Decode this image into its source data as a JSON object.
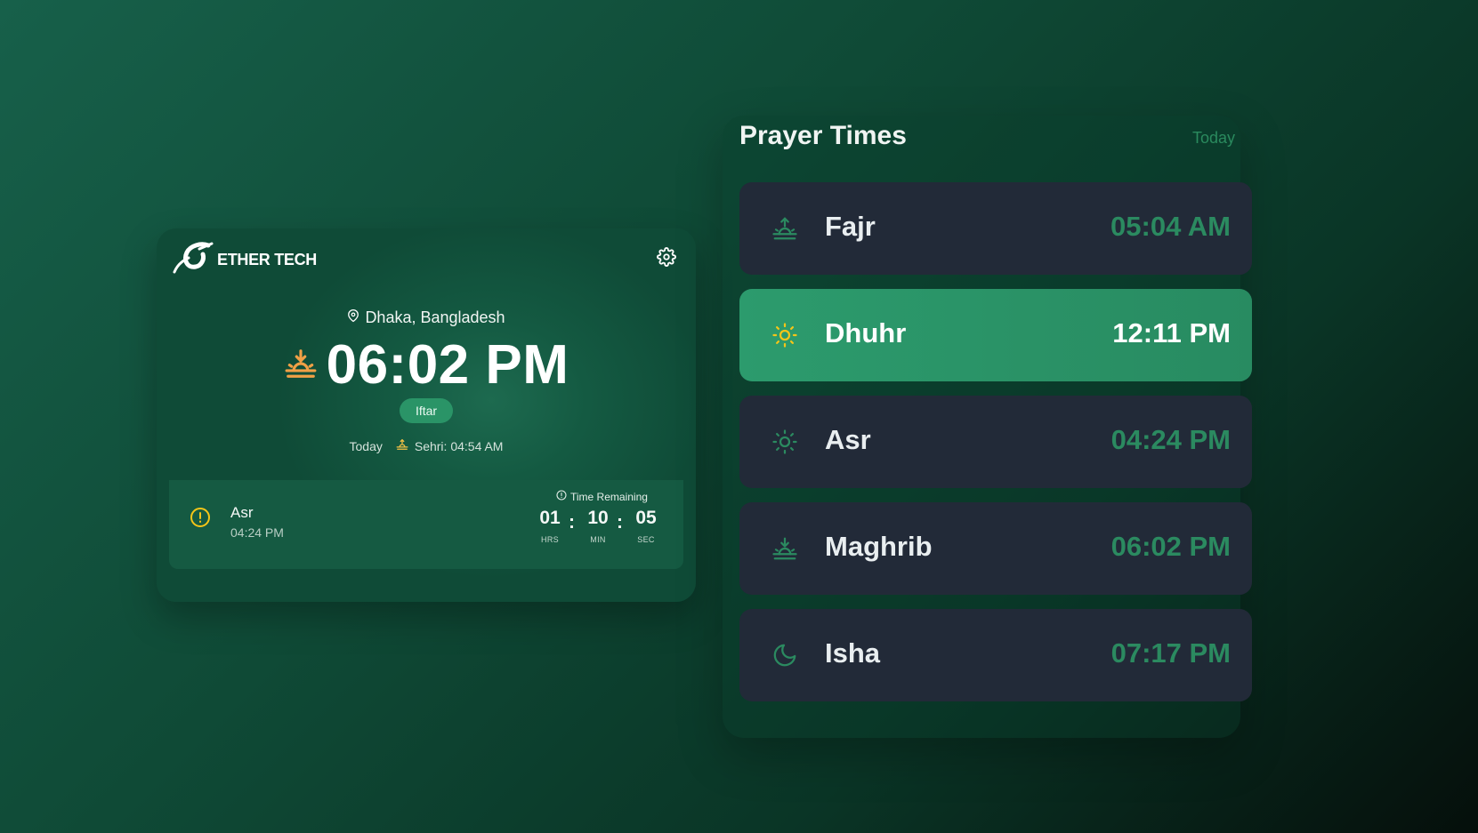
{
  "brand": {
    "name": "ETHER TECH",
    "logo_icon": "swirl-logo-icon"
  },
  "header": {
    "settings_icon": "gear-icon"
  },
  "clock": {
    "location": "Dhaka, Bangladesh",
    "time": "06:02 PM",
    "event_badge": "Iftar",
    "day_label": "Today",
    "sehri": "Sehri: 04:54 AM",
    "sunset_icon_color": "#f0a046",
    "sehri_icon_color": "#f5c245"
  },
  "next_prayer": {
    "name": "Asr",
    "time": "04:24 PM",
    "remaining_label": "Time Remaining",
    "countdown": {
      "hours": "01",
      "minutes": "10",
      "seconds": "05",
      "hours_label": "HRS",
      "minutes_label": "MIN",
      "seconds_label": "SEC",
      "separator": ":"
    },
    "icon_color": "#f5c518"
  },
  "prayer_times": {
    "title": "Prayer Times",
    "filter": "Today",
    "items": [
      {
        "name": "Fajr",
        "time": "05:04 AM",
        "icon": "sunrise-icon",
        "active": false
      },
      {
        "name": "Dhuhr",
        "time": "12:11 PM",
        "icon": "sun-icon",
        "active": true
      },
      {
        "name": "Asr",
        "time": "04:24 PM",
        "icon": "sun-outline-icon",
        "active": false
      },
      {
        "name": "Maghrib",
        "time": "06:02 PM",
        "icon": "sunset-icon",
        "active": false
      },
      {
        "name": "Isha",
        "time": "07:17 PM",
        "icon": "moon-icon",
        "active": false
      }
    ]
  },
  "colors": {
    "accent_green": "#2a9467",
    "card_dark": "#222a38",
    "time_green": "#2b8a60",
    "active_icon_yellow": "#f5c518"
  }
}
